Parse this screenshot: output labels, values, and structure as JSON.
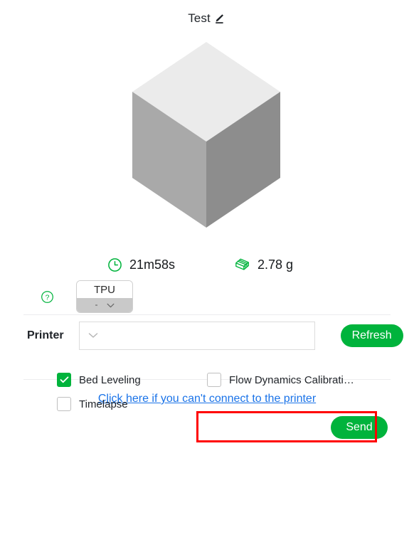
{
  "header": {
    "title": "Test",
    "edit_icon": "pencil-edit-icon"
  },
  "preview": {
    "model_shape": "isometric-cube",
    "colors": {
      "top_face": "#ebebeb",
      "left_face": "#a9a9a9",
      "right_face": "#8d8d8d"
    }
  },
  "stats": {
    "time": {
      "icon": "clock-icon",
      "value": "21m58s"
    },
    "weight": {
      "icon": "filament-spool-icon",
      "value": "2.78 g"
    }
  },
  "filament": {
    "help_icon": "question-mark-icon",
    "material": "TPU",
    "slot": "-",
    "chevron_icon": "chevron-down-icon"
  },
  "printer": {
    "label": "Printer",
    "chevron_icon": "chevron-down-icon",
    "selected": "",
    "placeholder": "",
    "refresh_label": "Refresh"
  },
  "options": [
    {
      "label": "Bed Leveling",
      "checked": true
    },
    {
      "label": "Timelapse",
      "checked": false
    },
    {
      "label": "Flow Dynamics Calibrati…",
      "checked": false
    }
  ],
  "footer": {
    "connect_link": "Click here if you can't connect to the printer",
    "send_label": "Send"
  },
  "theme": {
    "accent_green": "#00b33c",
    "link_blue": "#1a73e8",
    "highlight_red": "#ff0000"
  }
}
